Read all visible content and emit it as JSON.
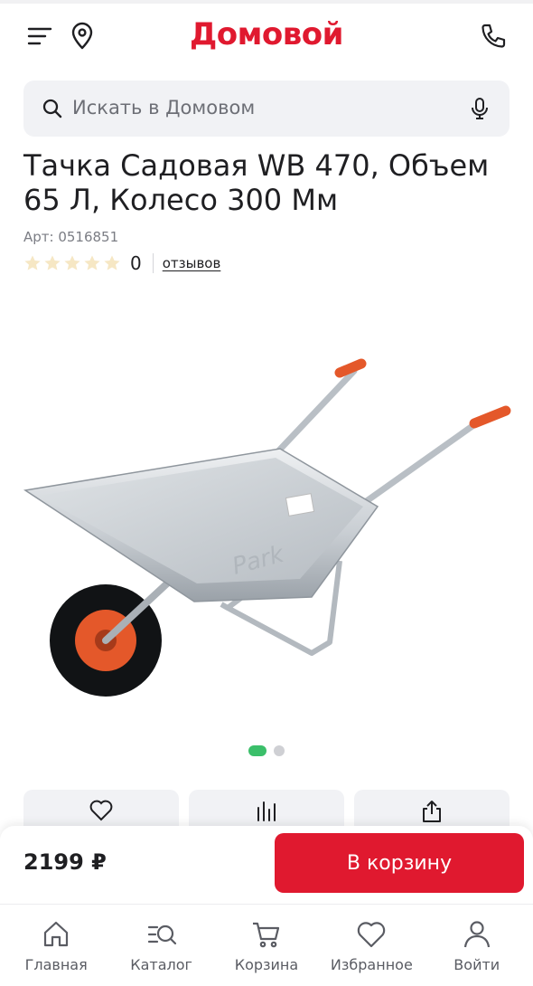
{
  "header": {
    "logo": "Домовой"
  },
  "search": {
    "placeholder": "Искать в Домовом"
  },
  "product": {
    "title": "Тачка Садовая WB 470, Объем 65 Л, Колесо 300 Мм",
    "sku": "Арт: 0516851",
    "rating_count": "0",
    "reviews_label": "отзывов",
    "rating_value": 0,
    "rating_max": 5,
    "image_count": 2,
    "active_image": 1
  },
  "buy": {
    "price": "2199 ₽",
    "button_label": "В корзину"
  },
  "colors": {
    "brand_red": "#e0192f",
    "dot_active": "#3bbf6a",
    "text": "#1f1f22"
  },
  "tabs": [
    {
      "label": "Главная",
      "icon": "home-icon"
    },
    {
      "label": "Каталог",
      "icon": "catalog-icon"
    },
    {
      "label": "Корзина",
      "icon": "cart-icon"
    },
    {
      "label": "Избранное",
      "icon": "heart-icon"
    },
    {
      "label": "Войти",
      "icon": "user-icon"
    }
  ]
}
